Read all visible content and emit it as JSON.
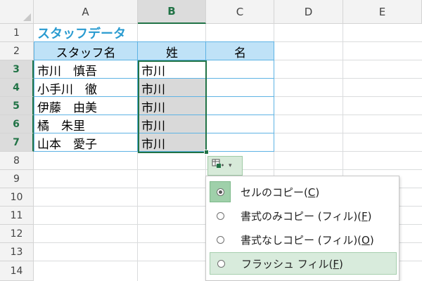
{
  "sheet": {
    "columns": [
      "A",
      "B",
      "C",
      "D",
      "E"
    ],
    "rows": [
      "1",
      "2",
      "3",
      "4",
      "5",
      "6",
      "7",
      "8",
      "9",
      "10",
      "11",
      "12",
      "13",
      "14"
    ],
    "selected_column": "B",
    "selected_rows": [
      "3",
      "4",
      "5",
      "6",
      "7"
    ]
  },
  "cells": {
    "a1": "スタッフデータ",
    "a2": "スタッフ名",
    "b2": "姓",
    "c2": "名",
    "a3": "市川　慎吾",
    "a4": "小手川　徹",
    "a5": "伊藤　由美",
    "a6": "橘　朱里",
    "a7": "山本　愛子",
    "b3": "市川",
    "b4": "市川",
    "b5": "市川",
    "b6": "市川",
    "b7": "市川"
  },
  "autofill_menu": {
    "button_icon": "autofill-options-icon",
    "caret": "▾",
    "items": [
      {
        "label": "セルのコピー(",
        "key": "C",
        "end": ")",
        "checked": true
      },
      {
        "label": "書式のみコピー (フィル)(",
        "key": "F",
        "end": ")",
        "checked": false
      },
      {
        "label": "書式なしコピー (フィル)(",
        "key": "O",
        "end": ")",
        "checked": false
      },
      {
        "label": "フラッシュ フィル(",
        "key": "F",
        "end": ")",
        "checked": false
      }
    ],
    "hovered_item": 3
  },
  "colors": {
    "accent_green": "#217346",
    "table_header_fill": "#bfe2f7",
    "table_border": "#5eb3e4",
    "title_blue": "#2a9bd0"
  }
}
